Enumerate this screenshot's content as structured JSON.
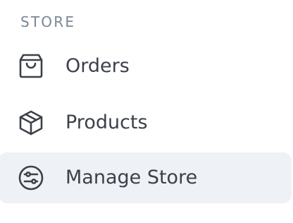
{
  "sidebar": {
    "section_title": "STORE",
    "items": [
      {
        "label": "Orders",
        "icon": "shopping-bag-icon",
        "active": false
      },
      {
        "label": "Products",
        "icon": "box-icon",
        "active": false
      },
      {
        "label": "Manage Store",
        "icon": "sliders-icon",
        "active": true
      }
    ],
    "colors": {
      "text": "#3c4049",
      "section_title": "#7b8794",
      "active_bg": "#eef1f5",
      "icon_stroke": "#3c4049"
    }
  }
}
